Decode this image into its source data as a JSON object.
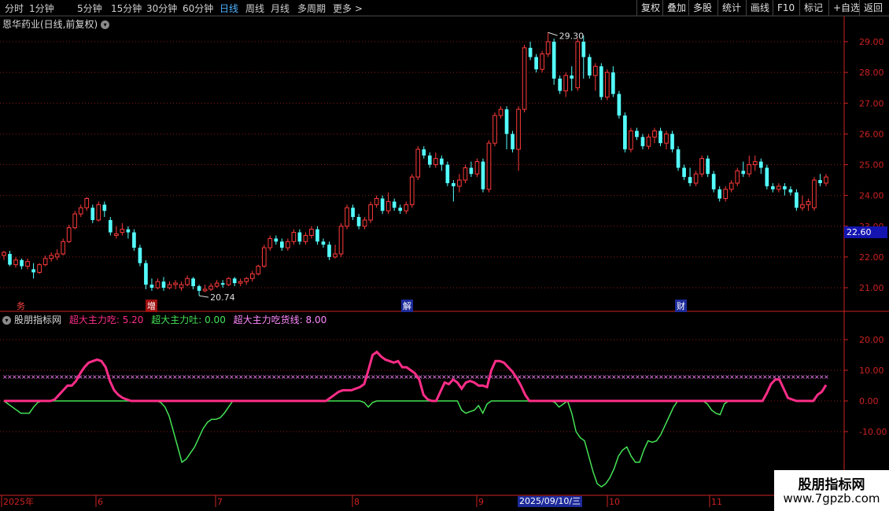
{
  "toolbar": {
    "periods": [
      "分时",
      "1分钟",
      "5分钟",
      "15分钟",
      "30分钟",
      "60分钟",
      "日线",
      "周线",
      "月线",
      "多周期",
      "更多 >"
    ],
    "active_period": "日线",
    "right_buttons": [
      "复权",
      "叠加",
      "多股",
      "统计",
      "画线",
      "F10",
      "标记",
      "+自选",
      "返回"
    ]
  },
  "stock": {
    "title": "恩华药业(日线,前复权)"
  },
  "price_axis": {
    "ticks": [
      "29.00",
      "28.00",
      "27.00",
      "26.00",
      "25.00",
      "24.00",
      "23.00",
      "22.00",
      "21.00"
    ],
    "current_price": "22.60"
  },
  "annotations": {
    "high": "29.30",
    "low": "20.74"
  },
  "events": [
    "务",
    "增",
    "解",
    "财"
  ],
  "indicator": {
    "name": "股朋指标网",
    "lines": [
      {
        "label": "超大主力吃: 5.20",
        "color": "#ff2d88"
      },
      {
        "label": "超大主力吐: 0.00",
        "color": "#44e255"
      },
      {
        "label": "超大主力吃货线: 8.00",
        "color": "#ff88ff"
      }
    ],
    "axis_ticks": [
      "20.00",
      "10.00",
      "0.00",
      "-10.00"
    ]
  },
  "date_axis": {
    "labels": [
      "2025年",
      "6",
      "7",
      "8",
      "9",
      "10",
      "11"
    ],
    "highlight": "2025/09/10/三"
  },
  "watermark": {
    "line1": "股朋指标网",
    "line2": "www.7gpzb.com"
  },
  "colors": {
    "up": "#ff3a3a",
    "down": "#54ffff",
    "grid": "#8b1a1a",
    "axis": "#cc2222"
  },
  "chart_data": {
    "type": "candlestick",
    "price_range": [
      20.6,
      29.6
    ],
    "indicator_range": [
      -23,
      25
    ],
    "candles": [
      [
        22.05,
        22.15,
        21.9,
        22.2
      ],
      [
        22.1,
        21.75,
        21.7,
        22.2
      ],
      [
        21.75,
        21.9,
        21.65,
        22.0
      ],
      [
        21.9,
        21.7,
        21.6,
        21.95
      ],
      [
        21.7,
        21.85,
        21.6,
        21.95
      ],
      [
        21.6,
        21.5,
        21.3,
        21.8
      ],
      [
        21.5,
        21.75,
        21.45,
        21.8
      ],
      [
        21.75,
        21.95,
        21.7,
        22.05
      ],
      [
        21.95,
        22.05,
        21.85,
        22.15
      ],
      [
        22.0,
        22.1,
        21.9,
        22.25
      ],
      [
        22.1,
        22.5,
        22.05,
        22.6
      ],
      [
        22.5,
        22.95,
        22.45,
        23.05
      ],
      [
        22.95,
        23.4,
        22.9,
        23.5
      ],
      [
        23.4,
        23.6,
        23.3,
        23.7
      ],
      [
        23.6,
        23.9,
        23.5,
        23.95
      ],
      [
        23.6,
        23.2,
        23.1,
        23.7
      ],
      [
        23.2,
        23.7,
        23.15,
        23.8
      ],
      [
        23.7,
        23.5,
        23.3,
        23.8
      ],
      [
        23.2,
        22.8,
        22.7,
        23.3
      ],
      [
        22.7,
        22.75,
        22.6,
        23.0
      ],
      [
        22.8,
        22.9,
        22.7,
        23.1
      ],
      [
        22.9,
        22.8,
        22.6,
        23.0
      ],
      [
        22.8,
        22.3,
        22.2,
        22.9
      ],
      [
        22.3,
        21.8,
        21.7,
        22.4
      ],
      [
        21.8,
        21.1,
        20.95,
        21.9
      ],
      [
        21.1,
        21.0,
        20.9,
        21.3
      ],
      [
        21.0,
        21.2,
        20.95,
        21.3
      ],
      [
        21.2,
        21.0,
        20.9,
        21.35
      ],
      [
        21.0,
        21.1,
        20.95,
        21.2
      ],
      [
        21.1,
        21.15,
        20.95,
        21.25
      ],
      [
        21.0,
        21.1,
        20.9,
        21.2
      ],
      [
        21.1,
        21.3,
        21.05,
        21.4
      ],
      [
        21.3,
        21.05,
        20.95,
        21.35
      ],
      [
        21.05,
        20.9,
        20.74,
        21.1
      ],
      [
        20.9,
        20.95,
        20.85,
        21.1
      ],
      [
        20.95,
        21.05,
        20.9,
        21.15
      ],
      [
        21.05,
        21.15,
        21.0,
        21.25
      ],
      [
        21.15,
        21.1,
        21.0,
        21.25
      ],
      [
        21.1,
        21.3,
        21.05,
        21.35
      ],
      [
        21.3,
        21.15,
        21.05,
        21.35
      ],
      [
        21.15,
        21.2,
        21.05,
        21.3
      ],
      [
        21.2,
        21.3,
        21.1,
        21.35
      ],
      [
        21.3,
        21.45,
        21.2,
        21.55
      ],
      [
        21.45,
        21.7,
        21.4,
        21.75
      ],
      [
        21.7,
        22.3,
        21.65,
        22.4
      ],
      [
        22.3,
        22.6,
        22.2,
        22.7
      ],
      [
        22.6,
        22.5,
        22.4,
        22.7
      ],
      [
        22.5,
        22.3,
        22.2,
        22.6
      ],
      [
        22.3,
        22.5,
        22.2,
        22.6
      ],
      [
        22.5,
        22.8,
        22.4,
        22.9
      ],
      [
        22.8,
        22.5,
        22.4,
        22.9
      ],
      [
        22.5,
        22.7,
        22.4,
        22.8
      ],
      [
        22.7,
        22.9,
        22.6,
        23.0
      ],
      [
        22.9,
        22.5,
        22.4,
        23.0
      ],
      [
        22.5,
        22.4,
        22.3,
        22.6
      ],
      [
        22.4,
        22.0,
        21.9,
        22.5
      ],
      [
        22.0,
        22.1,
        21.95,
        22.4
      ],
      [
        22.1,
        23.0,
        22.0,
        23.1
      ],
      [
        23.0,
        23.6,
        22.9,
        23.7
      ],
      [
        23.6,
        23.3,
        23.2,
        23.7
      ],
      [
        23.3,
        23.0,
        22.9,
        23.4
      ],
      [
        23.0,
        23.2,
        22.9,
        23.3
      ],
      [
        23.2,
        23.7,
        23.1,
        23.8
      ],
      [
        23.7,
        23.9,
        23.6,
        24.0
      ],
      [
        23.9,
        23.5,
        23.4,
        24.0
      ],
      [
        23.5,
        23.8,
        23.4,
        24.1
      ],
      [
        23.8,
        23.6,
        23.5,
        23.9
      ],
      [
        23.6,
        23.5,
        23.4,
        23.7
      ],
      [
        23.5,
        23.7,
        23.4,
        23.8
      ],
      [
        23.7,
        24.6,
        23.6,
        24.7
      ],
      [
        24.6,
        25.5,
        24.5,
        25.6
      ],
      [
        25.5,
        25.3,
        25.2,
        25.6
      ],
      [
        25.3,
        25.0,
        24.9,
        25.4
      ],
      [
        25.0,
        25.2,
        24.9,
        25.4
      ],
      [
        25.2,
        25.0,
        24.8,
        25.3
      ],
      [
        25.0,
        24.4,
        24.3,
        25.1
      ],
      [
        24.4,
        24.3,
        23.8,
        24.5
      ],
      [
        24.3,
        24.5,
        24.1,
        24.7
      ],
      [
        24.5,
        24.9,
        24.4,
        25.0
      ],
      [
        24.9,
        24.7,
        24.6,
        25.1
      ],
      [
        24.7,
        25.1,
        24.6,
        25.2
      ],
      [
        25.1,
        24.2,
        24.1,
        25.2
      ],
      [
        24.2,
        25.7,
        24.1,
        25.8
      ],
      [
        25.7,
        26.6,
        25.6,
        26.7
      ],
      [
        26.6,
        26.8,
        26.5,
        26.9
      ],
      [
        26.8,
        26.0,
        25.5,
        26.9
      ],
      [
        26.0,
        25.5,
        25.4,
        26.1
      ],
      [
        25.5,
        26.8,
        24.8,
        26.9
      ],
      [
        26.8,
        28.8,
        26.7,
        28.9
      ],
      [
        28.8,
        28.5,
        28.4,
        29.0
      ],
      [
        28.5,
        28.1,
        28.0,
        28.6
      ],
      [
        28.1,
        28.6,
        28.0,
        28.7
      ],
      [
        28.6,
        29.0,
        28.5,
        29.3
      ],
      [
        29.0,
        27.8,
        27.6,
        29.1
      ],
      [
        27.8,
        27.4,
        27.3,
        27.9
      ],
      [
        27.4,
        27.9,
        27.2,
        28.0
      ],
      [
        27.9,
        27.8,
        27.4,
        28.2
      ],
      [
        27.5,
        29.0,
        27.4,
        29.1
      ],
      [
        29.0,
        28.5,
        27.8,
        29.2
      ],
      [
        28.5,
        27.9,
        27.8,
        28.6
      ],
      [
        27.9,
        28.2,
        27.4,
        28.3
      ],
      [
        28.2,
        27.2,
        27.1,
        28.3
      ],
      [
        27.2,
        28.0,
        27.1,
        28.1
      ],
      [
        28.0,
        27.3,
        27.2,
        28.2
      ],
      [
        27.3,
        26.6,
        26.5,
        27.4
      ],
      [
        26.6,
        25.5,
        25.4,
        26.7
      ],
      [
        25.5,
        26.1,
        25.4,
        26.2
      ],
      [
        26.1,
        25.9,
        25.8,
        26.2
      ],
      [
        25.9,
        25.6,
        25.5,
        26.0
      ],
      [
        25.6,
        25.9,
        25.5,
        26.0
      ],
      [
        25.9,
        26.1,
        25.7,
        26.2
      ],
      [
        26.1,
        25.7,
        25.6,
        26.2
      ],
      [
        25.7,
        26.0,
        25.5,
        26.1
      ],
      [
        26.0,
        25.5,
        25.4,
        26.1
      ],
      [
        25.5,
        24.9,
        24.8,
        25.6
      ],
      [
        24.9,
        24.6,
        24.5,
        25.0
      ],
      [
        24.6,
        24.4,
        24.3,
        24.9
      ],
      [
        24.4,
        24.7,
        24.3,
        24.8
      ],
      [
        24.7,
        25.2,
        24.6,
        25.3
      ],
      [
        25.2,
        24.7,
        24.6,
        25.3
      ],
      [
        24.7,
        24.2,
        24.1,
        24.8
      ],
      [
        24.2,
        23.9,
        23.8,
        24.3
      ],
      [
        23.9,
        24.2,
        23.8,
        24.3
      ],
      [
        24.2,
        24.4,
        24.1,
        24.5
      ],
      [
        24.4,
        24.8,
        24.3,
        24.9
      ],
      [
        24.8,
        24.7,
        24.6,
        25.1
      ],
      [
        24.7,
        25.0,
        24.6,
        25.3
      ],
      [
        25.0,
        25.1,
        24.8,
        25.3
      ],
      [
        25.1,
        24.9,
        24.7,
        25.2
      ],
      [
        24.9,
        24.3,
        24.2,
        25.0
      ],
      [
        24.3,
        24.2,
        24.1,
        24.4
      ],
      [
        24.2,
        24.3,
        24.1,
        24.4
      ],
      [
        24.3,
        24.2,
        24.0,
        24.4
      ],
      [
        24.2,
        24.1,
        24.0,
        24.3
      ],
      [
        24.1,
        23.6,
        23.5,
        24.2
      ],
      [
        23.6,
        23.7,
        23.5,
        24.0
      ],
      [
        23.7,
        23.8,
        23.5,
        23.9
      ],
      [
        23.6,
        24.5,
        23.5,
        24.6
      ],
      [
        24.5,
        24.4,
        24.3,
        24.7
      ],
      [
        24.4,
        24.6,
        24.3,
        24.7
      ]
    ],
    "indicator_series": {
      "eat": [
        0,
        0,
        0,
        0,
        0,
        0,
        0,
        0,
        0,
        0,
        0,
        0,
        0.5,
        2,
        3.5,
        5,
        5,
        6.5,
        9,
        11,
        12.5,
        13,
        13.5,
        13,
        11,
        6.5,
        3.5,
        2,
        1,
        0.5,
        0,
        0,
        0,
        0,
        0,
        0,
        0,
        0,
        0,
        0,
        0,
        0,
        0,
        0,
        0,
        0,
        0,
        0,
        0,
        0,
        0,
        0,
        0,
        0,
        0,
        0,
        0,
        0,
        0,
        0,
        0,
        0,
        0,
        0,
        0,
        0,
        0,
        0,
        0,
        0,
        0,
        0,
        0,
        0,
        0,
        0,
        0,
        1,
        2,
        3,
        3.5,
        3.5,
        3.5,
        4,
        4.5,
        5.5,
        10,
        15,
        16,
        14.5,
        13.5,
        13,
        12.5,
        13,
        11,
        11,
        10,
        9,
        7,
        2,
        0.5,
        0,
        0,
        3,
        6,
        5.5,
        7,
        6,
        4,
        6,
        6.5,
        6,
        5,
        5,
        4.5,
        10,
        13,
        13,
        12.5,
        11,
        9.5,
        7.5,
        5,
        2,
        0,
        0,
        0,
        0,
        0,
        0,
        0,
        0,
        0,
        0,
        0,
        0,
        0,
        0,
        0,
        0,
        0,
        0,
        0,
        0,
        0,
        0,
        0,
        0,
        0,
        0,
        0,
        0,
        0,
        0,
        0,
        0,
        0,
        0,
        0,
        0,
        0,
        0,
        0,
        0,
        0,
        0,
        0,
        0,
        0,
        0,
        0,
        0,
        0,
        0,
        0,
        0,
        0,
        0,
        0,
        0,
        2.5,
        5.5,
        7,
        7,
        4,
        1,
        0.5,
        0,
        0,
        0,
        0,
        0,
        2,
        3,
        5.2
      ],
      "spit": [
        0,
        -1,
        -2,
        -3,
        -4,
        -4,
        -4,
        -2,
        -0.5,
        0,
        0,
        0,
        0,
        0,
        0,
        0,
        0,
        0,
        0,
        0,
        0,
        0,
        0,
        0,
        0,
        0,
        0,
        0,
        0,
        0,
        0,
        0,
        0,
        0,
        0,
        0,
        0,
        -0.5,
        -2,
        -5,
        -10,
        -15,
        -20,
        -19,
        -17,
        -15,
        -12,
        -9,
        -7,
        -6,
        -6,
        -5.5,
        -4,
        -2,
        0,
        0,
        0,
        0,
        0,
        0,
        0,
        0,
        0,
        0,
        0,
        0,
        0,
        0,
        0,
        0,
        0,
        0,
        0,
        0,
        0,
        0,
        0,
        0,
        0,
        0,
        0,
        0,
        0,
        0,
        0,
        -0.5,
        -2,
        -0.5,
        0,
        0,
        0,
        0,
        0,
        0,
        0,
        0,
        0,
        0,
        0,
        0,
        0,
        0,
        0,
        0,
        0,
        0,
        0,
        0,
        -3,
        -4,
        -3.5,
        -3,
        -1.5,
        -4,
        -1,
        0,
        0,
        0,
        0,
        0,
        0,
        0,
        0,
        0,
        0,
        0,
        0,
        0,
        0,
        0,
        -0.5,
        -2,
        -1,
        0,
        -4,
        -10,
        -12,
        -13,
        -18,
        -23,
        -27,
        -28,
        -27,
        -25,
        -22,
        -18,
        -16,
        -15,
        -18,
        -20,
        -20,
        -16,
        -13,
        -13.5,
        -13,
        -11,
        -8,
        -5,
        -2,
        0,
        0,
        0,
        0,
        0,
        0,
        0,
        -1,
        -3,
        -4,
        -4.5,
        -1,
        0,
        0
      ],
      "line": 8
    }
  }
}
